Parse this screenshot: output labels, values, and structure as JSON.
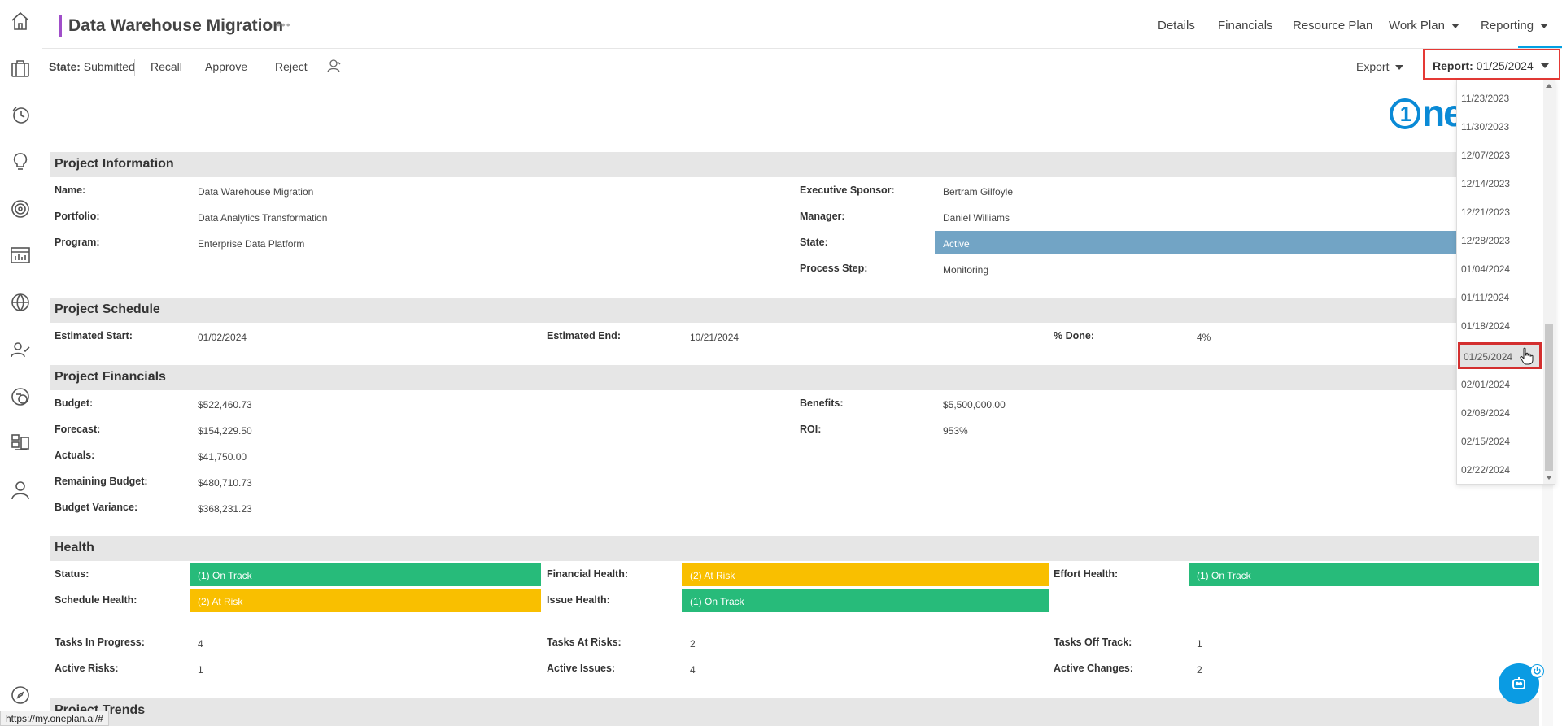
{
  "header": {
    "title": "Data Warehouse Migration",
    "title_more": "•••",
    "tabs": [
      {
        "label": "Details",
        "has_caret": false
      },
      {
        "label": "Financials",
        "has_caret": false
      },
      {
        "label": "Resource Plan",
        "has_caret": false
      },
      {
        "label": "Work Plan",
        "has_caret": true
      },
      {
        "label": "Reporting",
        "has_caret": true
      }
    ]
  },
  "toolbar": {
    "state_label": "State:",
    "state_value": "Submitted",
    "recall": "Recall",
    "approve": "Approve",
    "reject": "Reject",
    "export": "Export",
    "report_label": "Report:",
    "report_value": "01/25/2024"
  },
  "logo_text": "ne",
  "project_information": {
    "heading": "Project Information",
    "name_label": "Name:",
    "name": "Data Warehouse Migration",
    "portfolio_label": "Portfolio:",
    "portfolio": "Data Analytics Transformation",
    "program_label": "Program:",
    "program": "Enterprise Data Platform",
    "sponsor_label": "Executive Sponsor:",
    "sponsor": "Bertram Gilfoyle",
    "manager_label": "Manager:",
    "manager": "Daniel Williams",
    "state_label": "State:",
    "state": "Active",
    "process_label": "Process Step:",
    "process": "Monitoring"
  },
  "project_schedule": {
    "heading": "Project Schedule",
    "start_label": "Estimated Start:",
    "start": "01/02/2024",
    "end_label": "Estimated End:",
    "end": "10/21/2024",
    "done_label": "% Done:",
    "done": "4%"
  },
  "project_financials": {
    "heading": "Project Financials",
    "budget_label": "Budget:",
    "budget": "$522,460.73",
    "forecast_label": "Forecast:",
    "forecast": "$154,229.50",
    "actuals_label": "Actuals:",
    "actuals": "$41,750.00",
    "remaining_label": "Remaining Budget:",
    "remaining": "$480,710.73",
    "variance_label": "Budget Variance:",
    "variance": "$368,231.23",
    "benefits_label": "Benefits:",
    "benefits": "$5,500,000.00",
    "roi_label": "ROI:",
    "roi": "953%"
  },
  "health": {
    "heading": "Health",
    "status_label": "Status:",
    "status": "(1) On Track",
    "financial_label": "Financial Health:",
    "financial": "(2) At Risk",
    "effort_label": "Effort Health:",
    "effort": "(1) On Track",
    "schedule_label": "Schedule Health:",
    "schedule": "(2) At Risk",
    "issue_label": "Issue Health:",
    "issue": "(1) On Track",
    "tasks_in_progress_label": "Tasks In Progress:",
    "tasks_in_progress": "4",
    "tasks_at_risk_label": "Tasks At Risks:",
    "tasks_at_risk": "2",
    "tasks_off_track_label": "Tasks Off Track:",
    "tasks_off_track": "1",
    "active_risks_label": "Active Risks:",
    "active_risks": "1",
    "active_issues_label": "Active Issues:",
    "active_issues": "4",
    "active_changes_label": "Active Changes:",
    "active_changes": "2",
    "colors": {
      "on_track": "#27bb7a",
      "at_risk": "#f9bf00"
    }
  },
  "trends_heading": "Project Trends",
  "report_dropdown": {
    "items": [
      "11/23/2023",
      "11/30/2023",
      "12/07/2023",
      "12/14/2023",
      "12/21/2023",
      "12/28/2023",
      "01/04/2024",
      "01/11/2024",
      "01/18/2024",
      "01/25/2024",
      "02/01/2024",
      "02/08/2024",
      "02/15/2024",
      "02/22/2024"
    ],
    "selected": "01/25/2024"
  },
  "status_url": "https://my.oneplan.ai/#",
  "rail_icons": [
    "home-icon",
    "briefcase-icon",
    "clock-icon",
    "lightbulb-icon",
    "target-icon",
    "chart-icon",
    "globe-icon",
    "people-icon",
    "report-icon",
    "boards-icon",
    "user-icon",
    "compass-icon"
  ]
}
